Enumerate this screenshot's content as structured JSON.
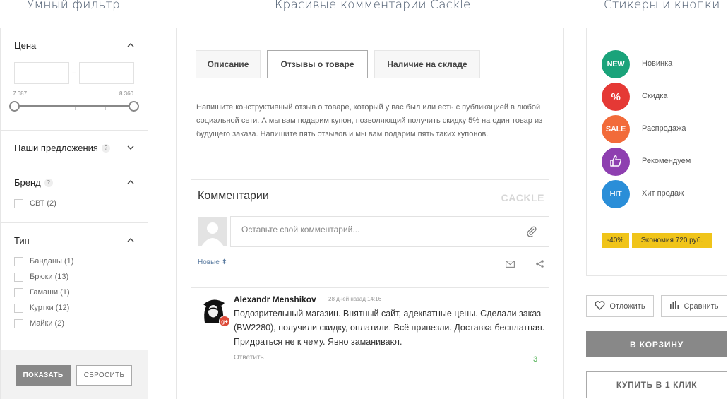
{
  "headings": {
    "filter": "Умный фильтр",
    "comments": "Красивые комментарии Cackle",
    "stickers": "Стикеры и кнопки"
  },
  "filter": {
    "price": {
      "title": "Цена",
      "min_label": "7 687",
      "max_label": "8 360",
      "from_value": "",
      "to_value": ""
    },
    "offers": {
      "title": "Наши предложения",
      "help": "?"
    },
    "brand": {
      "title": "Бренд",
      "help": "?",
      "items": [
        "СВТ (2)"
      ]
    },
    "type": {
      "title": "Тип",
      "items": [
        "Банданы (1)",
        "Брюки (13)",
        "Гамаши (1)",
        "Куртки (12)",
        "Майки (2)"
      ]
    },
    "show_button": "ПОКАЗАТЬ",
    "reset_button": "СБРОСИТЬ"
  },
  "product": {
    "tabs": [
      {
        "label": "Описание",
        "active": false
      },
      {
        "label": "Отзывы о товаре",
        "active": true
      },
      {
        "label": "Наличие на складе",
        "active": false
      }
    ],
    "review_text": "Напишите конструктивный отзыв о товаре, который у вас был или есть с публикацией в любой социальной сети. А мы вам подарим купон, позволяющий получить скидку 5% на один товар из будущего заказа. Напишите пять отзывов и мы вам подарим пять таких купонов.",
    "comments_title": "Комментарии",
    "brand_logo": "CACKLE",
    "comment_placeholder": "Оставьте свой комментарий...",
    "sort_label": "Новые",
    "comment": {
      "author": "Alexandr Menshikov",
      "date": "28 дней назад 14:16",
      "text": "Подозрительный магазин. Внятный сайт, адекватные цены. Сделали заказ (BW2280), получили скидку, оплатили. Всё  привезли. Доставка бесплатная. Придраться не к чему. Явно заманивают.",
      "reply_label": "Ответить",
      "score": "3",
      "network_badge": "g+"
    }
  },
  "stickers": [
    {
      "badge": "NEW",
      "label": "Новинка",
      "color": "#1aa37a"
    },
    {
      "badge": "%",
      "label": "Скидка",
      "color": "#e53935"
    },
    {
      "badge": "SALE",
      "label": "Распродажа",
      "color": "#f26b3a"
    },
    {
      "badge": "",
      "label": "Рекомендуем",
      "color": "#8e3fb0",
      "icon": "thumbs-up-icon"
    },
    {
      "badge": "HIT",
      "label": "Хит продаж",
      "color": "#2a8ed8"
    }
  ],
  "discount": {
    "percent": "-40%",
    "economy": "Экономия 720 руб."
  },
  "actions": {
    "wishlist": "Отложить",
    "compare": "Сравнить",
    "cart": "В КОРЗИНУ",
    "one_click": "КУПИТЬ В 1 КЛИК"
  }
}
